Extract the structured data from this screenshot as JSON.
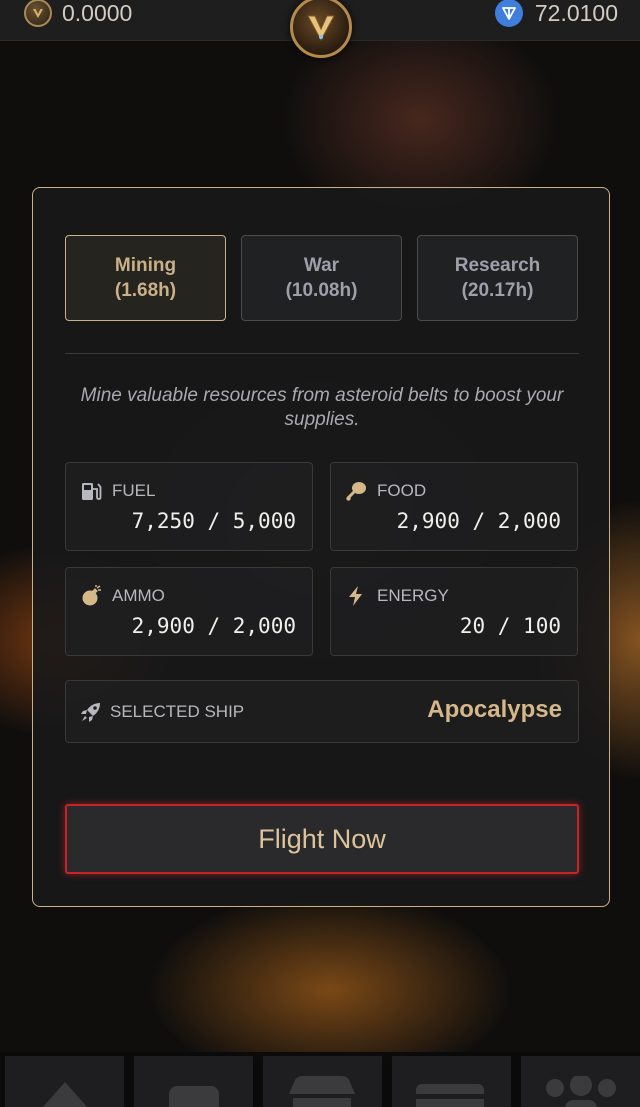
{
  "header": {
    "v_balance": "0.0000",
    "ton_balance": "72.0100",
    "logo_icon": "v-emblem-icon",
    "colors": {
      "gold": "#c9b089",
      "ton_blue": "#3f7fdb"
    }
  },
  "tabs": [
    {
      "label": "Mining",
      "duration": "(1.68h)",
      "active": true
    },
    {
      "label": "War",
      "duration": "(10.08h)",
      "active": false
    },
    {
      "label": "Research",
      "duration": "(20.17h)",
      "active": false
    }
  ],
  "description": "Mine valuable resources from asteroid belts to boost your supplies.",
  "resources": [
    {
      "label": "FUEL",
      "value": "7,250 / 5,000",
      "icon": "fuel-pump-icon"
    },
    {
      "label": "FOOD",
      "value": "2,900 / 2,000",
      "icon": "drumstick-icon"
    },
    {
      "label": "AMMO",
      "value": "2,900 / 2,000",
      "icon": "bomb-icon"
    },
    {
      "label": "ENERGY",
      "value": "20 / 100",
      "icon": "bolt-icon"
    }
  ],
  "ship": {
    "label": "SELECTED SHIP",
    "name": "Apocalypse",
    "icon": "rocket-icon"
  },
  "action": {
    "label": "Flight Now",
    "border_color": "#c4242a"
  },
  "nav": [
    {
      "icon": "home-icon"
    },
    {
      "icon": "square-icon"
    },
    {
      "icon": "store-icon"
    },
    {
      "icon": "wallet-icon"
    },
    {
      "icon": "users-icon"
    }
  ]
}
